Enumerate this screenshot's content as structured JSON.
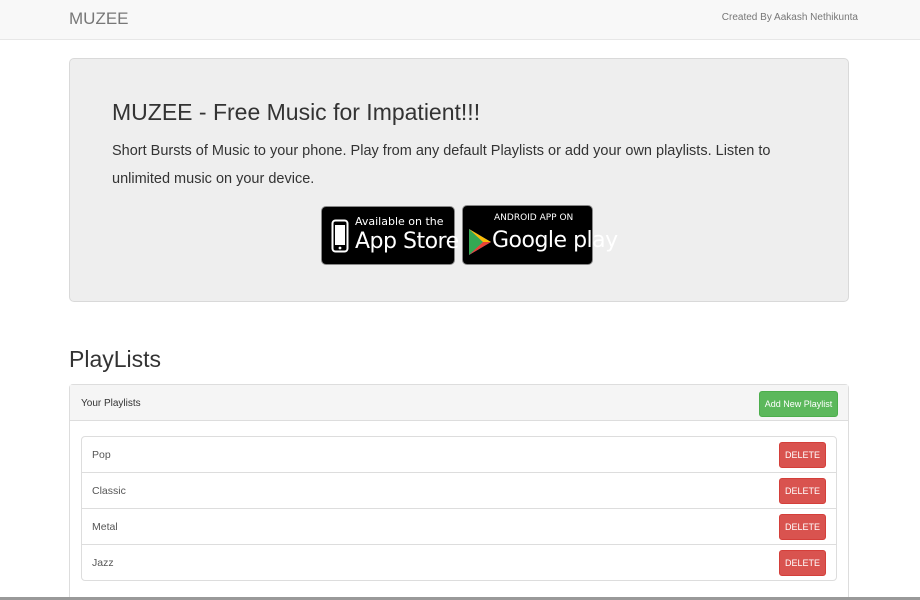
{
  "navbar": {
    "brand": "MUZEE",
    "credit": "Created By Aakash Nethikunta"
  },
  "jumbotron": {
    "title": "MUZEE - Free Music for Impatient!!!",
    "description": "Short Bursts of Music to your phone. Play from any default Playlists or add your own playlists. Listen to unlimited music on your device.",
    "app_store_badge": {
      "small": "Available on the",
      "big": "App Store",
      "icon": "apple-phone-icon"
    },
    "google_play_badge": {
      "small": "ANDROID APP ON",
      "big": "Google play",
      "icon": "google-play-triangle-icon"
    }
  },
  "playlists_section": {
    "title": "PlayLists",
    "panel_heading": "Your Playlists",
    "add_button": "Add New Playlist",
    "items": [
      {
        "label": "Pop",
        "delete_label": "DELETE"
      },
      {
        "label": "Classic",
        "delete_label": "DELETE"
      },
      {
        "label": "Metal",
        "delete_label": "DELETE"
      },
      {
        "label": "Jazz",
        "delete_label": "DELETE"
      }
    ]
  },
  "colors": {
    "navbar_bg": "#f8f8f8",
    "jumbotron_bg": "#eeeeee",
    "success": "#5cb85c",
    "danger": "#d9534f"
  }
}
